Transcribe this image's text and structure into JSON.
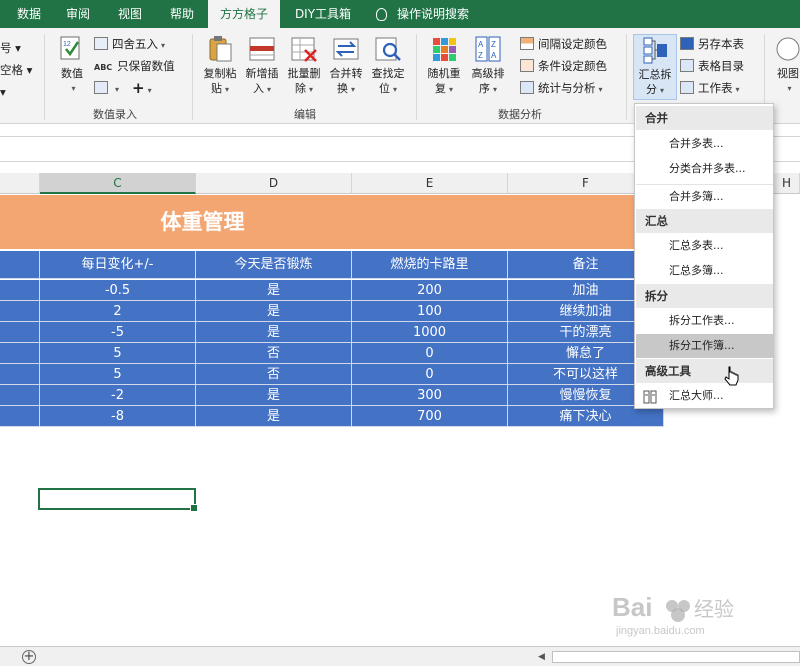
{
  "tabs": [
    "数据",
    "审阅",
    "视图",
    "帮助",
    "方方格子",
    "DIY工具箱",
    "操作说明搜索"
  ],
  "ribbon": {
    "left_partial": [
      "号 ▾",
      "空格 ▾"
    ],
    "numeric_group": {
      "label": "数值录入",
      "value_btn": "数值",
      "round_btn": "四舍五入",
      "keep_value_btn": "只保留数值",
      "plus_btn": "+"
    },
    "edit_group": {
      "label": "编辑",
      "copy_paste": [
        "复制粘",
        "贴"
      ],
      "insert": [
        "新增插",
        "入"
      ],
      "batch_delete": [
        "批量删",
        "除"
      ],
      "merge_convert": [
        "合并转",
        "换"
      ],
      "find_locate": [
        "查找定",
        "位"
      ]
    },
    "analysis_group": {
      "label": "数据分析",
      "random_reorder": [
        "随机重",
        "复"
      ],
      "advanced_sort": [
        "高级排",
        "序"
      ],
      "interval_color": "间隔设定颜色",
      "condition_color": "条件设定颜色",
      "stats": "统计与分析"
    },
    "summary_group": {
      "summary_split": [
        "汇总拆",
        "分"
      ],
      "save_as_table": "另存本表",
      "table_dir": "表格目录",
      "worksheet": "工作表"
    },
    "right_partial": "视图"
  },
  "columns": [
    "C",
    "D",
    "E",
    "F",
    "H"
  ],
  "sheet": {
    "title": "体重管理",
    "headers": [
      "每日变化+/-",
      "今天是否锻炼",
      "燃烧的卡路里",
      "备注"
    ],
    "rows": [
      [
        "-0.5",
        "是",
        "200",
        "加油"
      ],
      [
        "2",
        "是",
        "100",
        "继续加油"
      ],
      [
        "-5",
        "是",
        "1000",
        "干的漂亮"
      ],
      [
        "5",
        "否",
        "0",
        "懈怠了"
      ],
      [
        "5",
        "否",
        "0",
        "不可以这样"
      ],
      [
        "-2",
        "是",
        "300",
        "慢慢恢复"
      ],
      [
        "-8",
        "是",
        "700",
        "痛下决心"
      ]
    ]
  },
  "menu": {
    "sections": [
      {
        "title": "合并",
        "items": [
          "合并多表...",
          "分类合并多表...",
          "合并多簿..."
        ]
      },
      {
        "title": "汇总",
        "items": [
          "汇总多表...",
          "汇总多簿..."
        ]
      },
      {
        "title": "拆分",
        "items": [
          "拆分工作表...",
          "拆分工作簿..."
        ]
      },
      {
        "title": "高级工具",
        "items": [
          "汇总大师..."
        ]
      }
    ],
    "hovered_item": "拆分工作簿..."
  },
  "colors": {
    "ribbon_green": "#217346",
    "title_band": "#f4a672",
    "table_blue": "#4472c4",
    "selection_green": "#217346",
    "menu_hover": "#c8c8c8"
  },
  "watermark": "Bai 经验 jingyan.baidu.com"
}
